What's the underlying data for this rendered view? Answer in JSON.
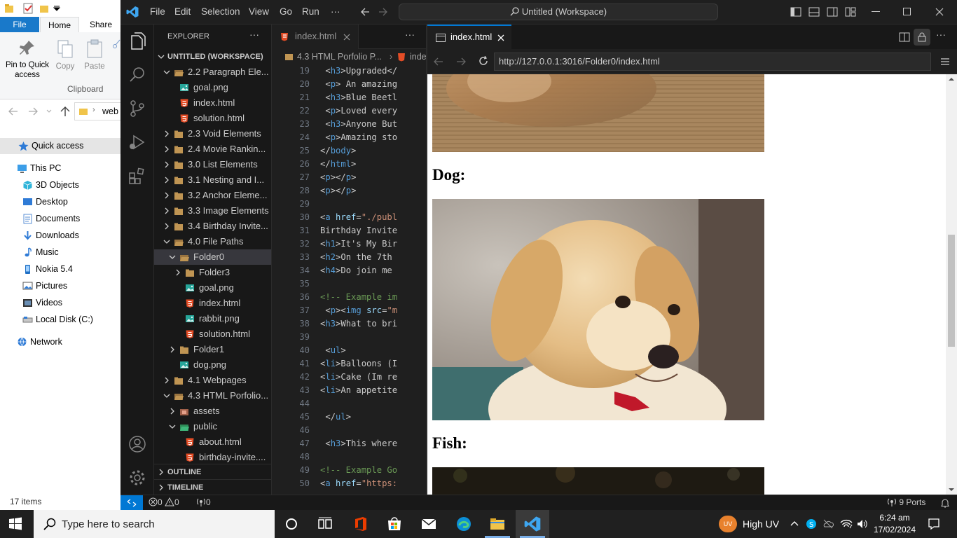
{
  "explorer": {
    "tabs": {
      "file": "File",
      "home": "Home",
      "share": "Share"
    },
    "ribbon": {
      "pin": "Pin to Quick\naccess",
      "copy": "Copy",
      "paste": "Paste",
      "group": "Clipboard"
    },
    "address": "web",
    "nav": [
      {
        "label": "Quick access",
        "icon": "star-icon"
      },
      {
        "label": "This PC",
        "icon": "pc-icon"
      },
      {
        "label": "3D Objects",
        "icon": "cube-icon"
      },
      {
        "label": "Desktop",
        "icon": "desktop-icon"
      },
      {
        "label": "Documents",
        "icon": "documents-icon"
      },
      {
        "label": "Downloads",
        "icon": "download-icon"
      },
      {
        "label": "Music",
        "icon": "music-icon"
      },
      {
        "label": "Nokia 5.4",
        "icon": "phone-icon"
      },
      {
        "label": "Pictures",
        "icon": "pictures-icon"
      },
      {
        "label": "Videos",
        "icon": "videos-icon"
      },
      {
        "label": "Local Disk (C:)",
        "icon": "disk-icon"
      },
      {
        "label": "Network",
        "icon": "network-icon"
      }
    ],
    "status": "17 items"
  },
  "vscode": {
    "menu": [
      "File",
      "Edit",
      "Selection",
      "View",
      "Go",
      "Run",
      "···"
    ],
    "command_center": "Untitled (Workspace)",
    "sidebar": {
      "title": "EXPLORER",
      "workspace": "UNTITLED (WORKSPACE)",
      "tree": [
        {
          "label": "2.2 Paragraph Ele...",
          "type": "folder",
          "open": true
        },
        {
          "label": "goal.png",
          "type": "image"
        },
        {
          "label": "index.html",
          "type": "html"
        },
        {
          "label": "solution.html",
          "type": "html"
        },
        {
          "label": "2.3 Void Elements",
          "type": "folder",
          "open": false
        },
        {
          "label": "2.4 Movie Rankin...",
          "type": "folder",
          "open": false
        },
        {
          "label": "3.0 List Elements",
          "type": "folder",
          "open": false
        },
        {
          "label": "3.1 Nesting and I...",
          "type": "folder",
          "open": false
        },
        {
          "label": "3.2 Anchor Eleme...",
          "type": "folder",
          "open": false
        },
        {
          "label": "3.3 Image Elements",
          "type": "folder",
          "open": false
        },
        {
          "label": "3.4 Birthday Invite...",
          "type": "folder",
          "open": false
        },
        {
          "label": "4.0 File Paths",
          "type": "folder",
          "open": true
        },
        {
          "label": "Folder0",
          "type": "folder",
          "open": true
        },
        {
          "label": "Folder3",
          "type": "folder",
          "open": false
        },
        {
          "label": "goal.png",
          "type": "image"
        },
        {
          "label": "index.html",
          "type": "html"
        },
        {
          "label": "rabbit.png",
          "type": "image"
        },
        {
          "label": "solution.html",
          "type": "html"
        },
        {
          "label": "Folder1",
          "type": "folder",
          "open": false
        },
        {
          "label": "dog.png",
          "type": "image"
        },
        {
          "label": "4.1 Webpages",
          "type": "folder",
          "open": false
        },
        {
          "label": "4.3 HTML Porfolio...",
          "type": "folder",
          "open": true
        },
        {
          "label": "assets",
          "type": "folder",
          "open": false
        },
        {
          "label": "public",
          "type": "folder",
          "open": true
        },
        {
          "label": "about.html",
          "type": "html"
        },
        {
          "label": "birthday-invite....",
          "type": "html"
        }
      ],
      "outline": "OUTLINE",
      "timeline": "TIMELINE"
    },
    "editor_tab": "index.html",
    "breadcrumb": [
      "4.3 HTML Porfolio P...",
      "inde"
    ],
    "code": [
      {
        "n": "19",
        "t": " <h3>Upgraded</"
      },
      {
        "n": "20",
        "t": " <p> An amazing"
      },
      {
        "n": "21",
        "t": " <h3>Blue Beetl"
      },
      {
        "n": "22",
        "t": " <p>Loved every"
      },
      {
        "n": "23",
        "t": " <h3>Anyone But"
      },
      {
        "n": "24",
        "t": " <p>Amazing sto"
      },
      {
        "n": "25",
        "t": "</body>"
      },
      {
        "n": "26",
        "t": "</html>"
      },
      {
        "n": "27",
        "t": "<p></p>"
      },
      {
        "n": "28",
        "t": "<p></p>"
      },
      {
        "n": "29",
        "t": ""
      },
      {
        "n": "30",
        "t": "<a href=\"./publ"
      },
      {
        "n": "31",
        "t": "Birthday Invite"
      },
      {
        "n": "32",
        "t": "<h1>It's My Bir"
      },
      {
        "n": "33",
        "t": "<h2>On the 7th"
      },
      {
        "n": "34",
        "t": "<h4>Do join me"
      },
      {
        "n": "35",
        "t": ""
      },
      {
        "n": "36",
        "t": "<!-- Example im"
      },
      {
        "n": "37",
        "t": " <p><img src=\"m"
      },
      {
        "n": "38",
        "t": "<h3>What to bri"
      },
      {
        "n": "39",
        "t": ""
      },
      {
        "n": "40",
        "t": " <ul>"
      },
      {
        "n": "41",
        "t": "<li>Balloons (I"
      },
      {
        "n": "42",
        "t": "<li>Cake (Im re"
      },
      {
        "n": "43",
        "t": "<li>An appetite"
      },
      {
        "n": "44",
        "t": ""
      },
      {
        "n": "45",
        "t": " </ul>"
      },
      {
        "n": "46",
        "t": ""
      },
      {
        "n": "47",
        "t": " <h3>This where"
      },
      {
        "n": "48",
        "t": ""
      },
      {
        "n": "49",
        "t": "<!-- Example Go"
      },
      {
        "n": "50",
        "t": "<a href=\"https:"
      }
    ],
    "preview": {
      "tab": "index.html",
      "url": "http://127.0.0.1:3016/Folder0/index.html",
      "headings": [
        "Dog:",
        "Fish:"
      ]
    },
    "status": {
      "errors": "0",
      "warnings": "0",
      "ports_count": "0",
      "ports": "9 Ports"
    }
  },
  "taskbar": {
    "search_placeholder": "Type here to search",
    "weather": "High UV",
    "weather_badge": "UV",
    "time": "6:24 am",
    "date": "17/02/2024"
  }
}
